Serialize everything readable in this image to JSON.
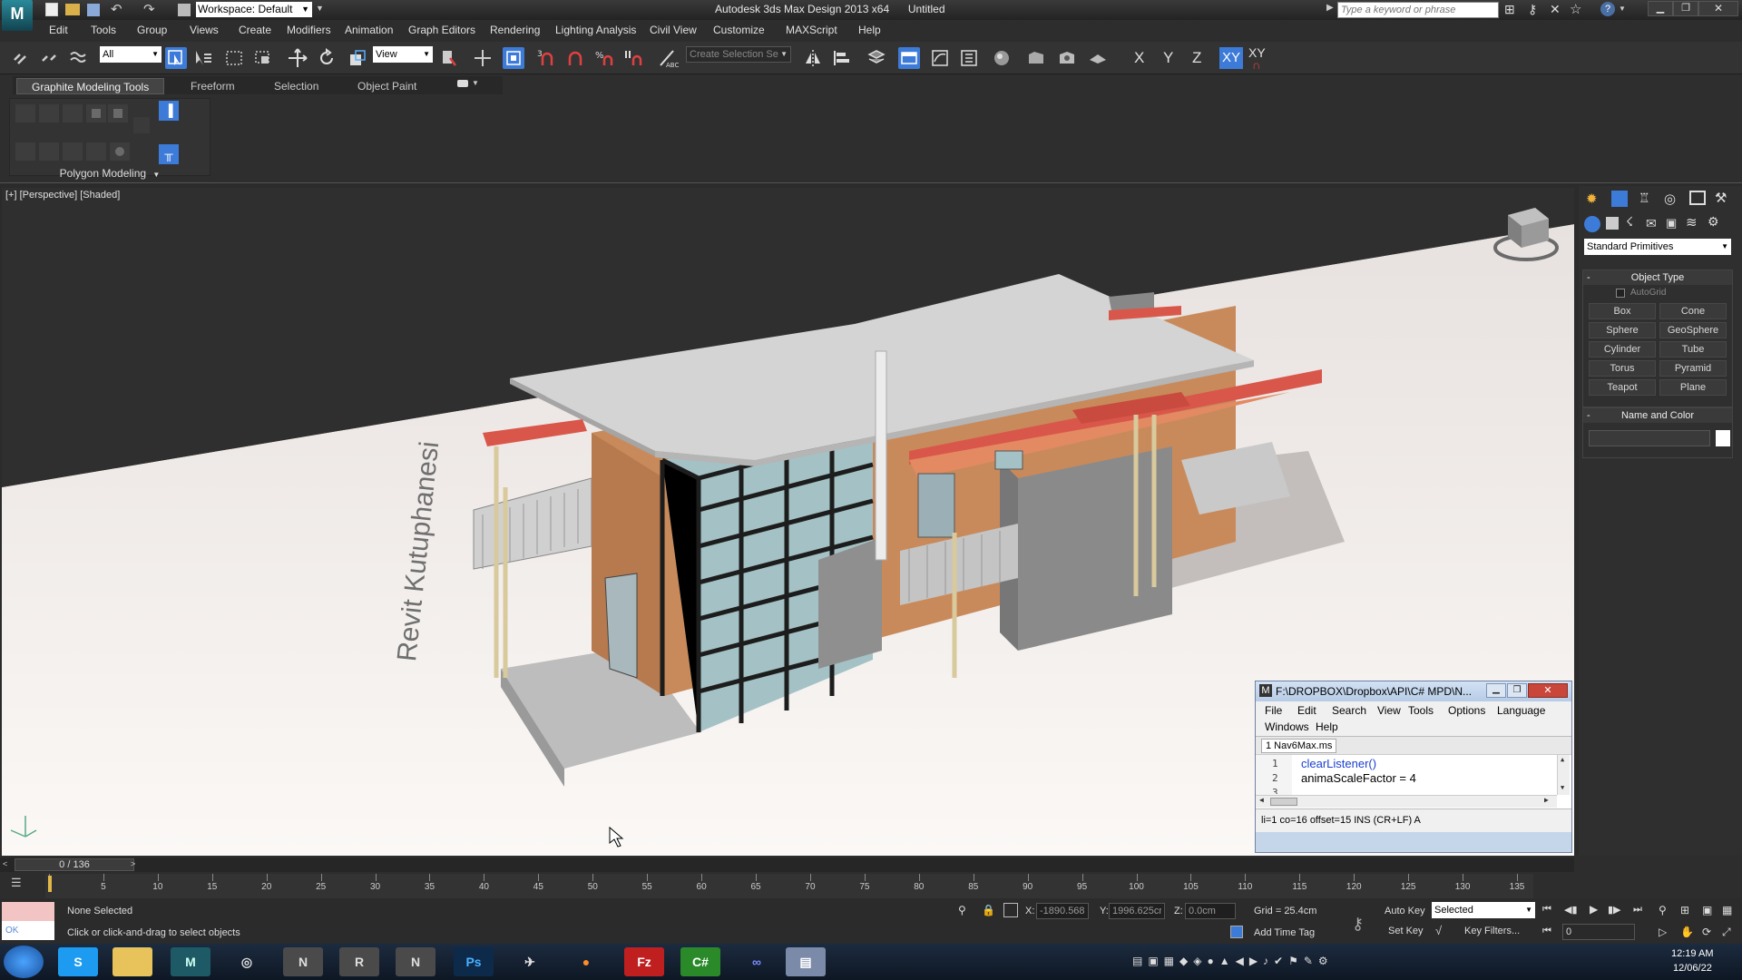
{
  "app": {
    "title": "Autodesk 3ds Max Design 2013 x64",
    "document": "Untitled",
    "workspace": "Workspace: Default",
    "search_placeholder": "Type a keyword or phrase"
  },
  "menu": [
    "Edit",
    "Tools",
    "Group",
    "Views",
    "Create",
    "Modifiers",
    "Animation",
    "Graph Editors",
    "Rendering",
    "Lighting Analysis",
    "Civil View",
    "Customize",
    "MAXScript",
    "Help"
  ],
  "toolbar": {
    "selection_filter": "All",
    "ref_coord": "View",
    "named_selection_placeholder": "Create Selection Se",
    "axes": [
      "X",
      "Y",
      "Z",
      "XY",
      "XY"
    ]
  },
  "ribbon": {
    "tabs": [
      "Graphite Modeling Tools",
      "Freeform",
      "Selection",
      "Object Paint"
    ],
    "panel_label": "Polygon Modeling"
  },
  "viewport": {
    "label": "[+] [Perspective] [Shaded]",
    "model_text": "Revit Kutuphanesi"
  },
  "command_panel": {
    "category": "Standard Primitives",
    "object_type_title": "Object Type",
    "autogrid": "AutoGrid",
    "primitives": [
      "Box",
      "Cone",
      "Sphere",
      "GeoSphere",
      "Cylinder",
      "Tube",
      "Torus",
      "Pyramid",
      "Teapot",
      "Plane"
    ],
    "name_color_title": "Name and Color"
  },
  "maxscript": {
    "title": "F:\\DROPBOX\\Dropbox\\API\\C# MPD\\N...",
    "menu": [
      "File",
      "Edit",
      "Search",
      "View",
      "Tools",
      "Options",
      "Language",
      "Windows",
      "Help"
    ],
    "tab": "1 Nav6Max.ms",
    "lines": [
      {
        "num": "1",
        "code": "clearListener()"
      },
      {
        "num": "2",
        "code": "animaScaleFactor = 4"
      },
      {
        "num": "3",
        "code": ""
      }
    ],
    "status": "li=1 co=16 offset=15 INS (CR+LF) A"
  },
  "timeline": {
    "frame": "0 / 136",
    "ticks": [
      "0",
      "5",
      "10",
      "15",
      "20",
      "25",
      "30",
      "35",
      "40",
      "45",
      "50",
      "55",
      "60",
      "65",
      "70",
      "75",
      "80",
      "85",
      "90",
      "95",
      "100",
      "105",
      "110",
      "115",
      "120",
      "125",
      "130",
      "135"
    ]
  },
  "status": {
    "selection": "None Selected",
    "prompt": "Click or click-and-drag to select objects",
    "x": "-1890.568cr",
    "y": "1996.625cr",
    "z": "0.0cm",
    "grid": "Grid = 25.4cm",
    "add_time_tag": "Add Time Tag",
    "auto_key": "Auto Key",
    "set_key": "Set Key",
    "key_mode": "Selected",
    "key_filters": "Key Filters...",
    "frame_value": "0",
    "listener_text": "OK"
  },
  "taskbar": {
    "time": "12:19 AM",
    "date": "12/06/22"
  },
  "colors": {
    "accent": "#3d7bd9",
    "roof_red": "#d9574a",
    "wall_orange": "#c98a5b"
  }
}
